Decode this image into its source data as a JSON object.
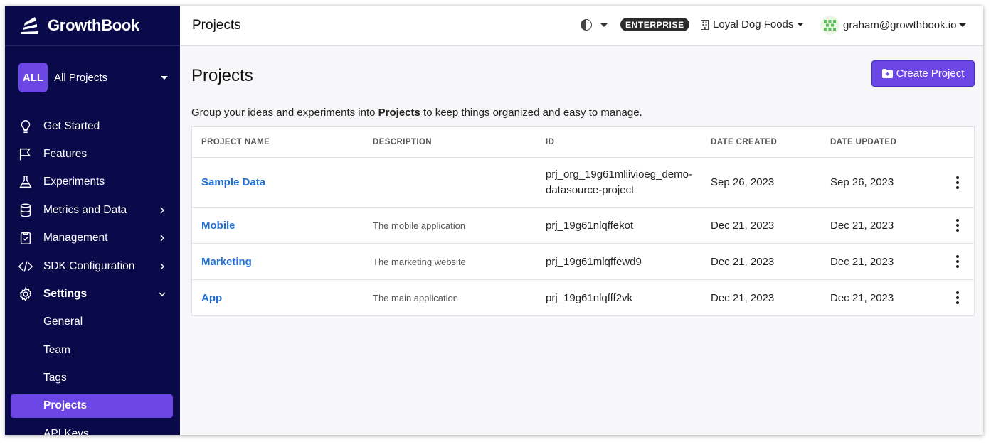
{
  "app": {
    "name": "GrowthBook"
  },
  "sidebar": {
    "project_badge": "ALL",
    "project_label": "All Projects",
    "items": [
      {
        "label": "Get Started",
        "icon": "lightbulb-icon",
        "chevron": false
      },
      {
        "label": "Features",
        "icon": "flag-icon",
        "chevron": false
      },
      {
        "label": "Experiments",
        "icon": "flask-icon",
        "chevron": false
      },
      {
        "label": "Metrics and Data",
        "icon": "database-icon",
        "chevron": true
      },
      {
        "label": "Management",
        "icon": "clipboard-check-icon",
        "chevron": true
      },
      {
        "label": "SDK Configuration",
        "icon": "code-icon",
        "chevron": true
      },
      {
        "label": "Settings",
        "icon": "gear-icon",
        "chevron": true,
        "expanded": true
      }
    ],
    "settings_subitems": [
      "General",
      "Team",
      "Tags",
      "Projects",
      "API Keys"
    ],
    "active_subitem": "Projects"
  },
  "topbar": {
    "title": "Projects",
    "plan_badge": "ENTERPRISE",
    "org_name": "Loyal Dog Foods",
    "user_email": "graham@growthbook.io"
  },
  "main": {
    "title": "Projects",
    "create_button": "Create Project",
    "intro_before": "Group your ideas and experiments into ",
    "intro_bold": "Projects",
    "intro_after": " to keep things organized and easy to manage.",
    "columns": [
      "PROJECT NAME",
      "DESCRIPTION",
      "ID",
      "DATE CREATED",
      "DATE UPDATED"
    ],
    "rows": [
      {
        "name": "Sample Data",
        "description": "",
        "id_line1": "prj_org_19g61mliivioeg_demo-",
        "id_line2": "datasource-project",
        "created": "Sep 26, 2023",
        "updated": "Sep 26, 2023"
      },
      {
        "name": "Mobile",
        "description": "The mobile application",
        "id_line1": "prj_19g61nlqffekot",
        "id_line2": "",
        "created": "Dec 21, 2023",
        "updated": "Dec 21, 2023"
      },
      {
        "name": "Marketing",
        "description": "The marketing website",
        "id_line1": "prj_19g61mlqffewd9",
        "id_line2": "",
        "created": "Dec 21, 2023",
        "updated": "Dec 21, 2023"
      },
      {
        "name": "App",
        "description": "The main application",
        "id_line1": "prj_19g61nlqfff2vk",
        "id_line2": "",
        "created": "Dec 21, 2023",
        "updated": "Dec 21, 2023"
      }
    ]
  },
  "colors": {
    "sidebar_bg": "#0a0a4a",
    "accent": "#6b46e5",
    "link": "#1f6fd6"
  }
}
